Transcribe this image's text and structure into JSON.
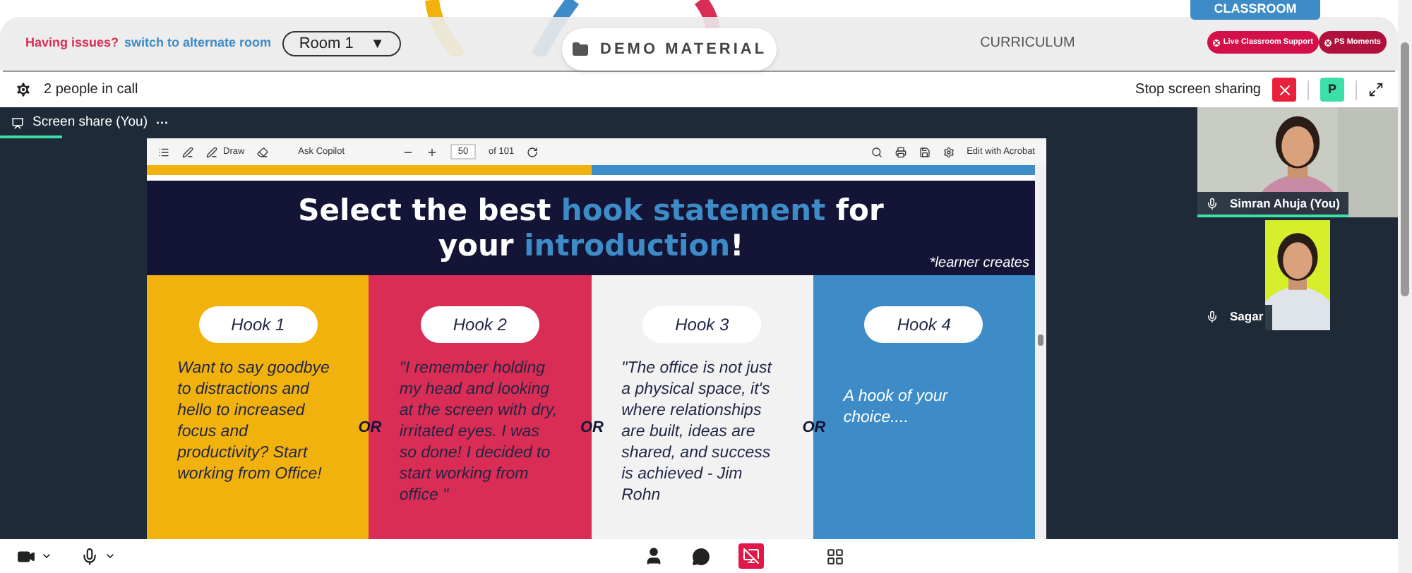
{
  "header": {
    "issue_text": "Having issues?",
    "issue_link": "switch to alternate room",
    "room_select": "Room 1",
    "room_caret": "▼",
    "tabs": [
      {
        "label": "DEMO MATERIAL",
        "selected": true
      },
      {
        "label": "CURRICULUM",
        "selected": false
      }
    ],
    "classroom_tab": "CLASSROOM",
    "buttons": [
      "Live Classroom Support",
      "PS Moments"
    ]
  },
  "call_bar": {
    "participants": "2 people in call",
    "stop_sharing": "Stop screen sharing",
    "avatar": "P"
  },
  "share_label": "Screen share (You)",
  "share_more": "···",
  "pdf_toolbar": {
    "draw": "Draw",
    "ask": "Ask Copilot",
    "page": "50",
    "page_total": "of 101",
    "edit": "Edit with Acrobat"
  },
  "slide": {
    "title_line_1": [
      {
        "text": "Select the best ",
        "highlight": false
      },
      {
        "text": "hook statement",
        "highlight": true
      },
      {
        "text": " for",
        "highlight": false
      }
    ],
    "title_line_2": [
      {
        "text": "your ",
        "highlight": false
      },
      {
        "text": "introduction",
        "highlight": true
      },
      {
        "text": "!",
        "highlight": false
      }
    ],
    "note": "*learner creates",
    "hooks": [
      {
        "label": "Hook 1",
        "kind": "sample",
        "color": "#f2b20e",
        "text": "Want to say goodbye to distractions and hello to increased focus and productivity? Start working from Office!"
      },
      {
        "label": "Hook 2",
        "kind": "sample",
        "color": "#d92d55",
        "text": "\"I remember holding my head and looking at the screen with dry, irritated eyes. I was so done! I decided to start working from office \""
      },
      {
        "label": "Hook 3",
        "kind": "sample",
        "color": "#f2f2f2",
        "text": "\"The office is not just a physical space, it's where relationships are built, ideas are shared, and success is achieved - Jim Rohn"
      },
      {
        "label": "Hook 4",
        "kind": "open",
        "color": "#3d8bc7",
        "text": "A hook of your choice...."
      }
    ],
    "separators": [
      "OR",
      "OR",
      "OR"
    ]
  },
  "participants": [
    {
      "name": "Simran Ahuja (You)",
      "speaking": true
    },
    {
      "name": "Sagar",
      "speaking": false
    }
  ]
}
